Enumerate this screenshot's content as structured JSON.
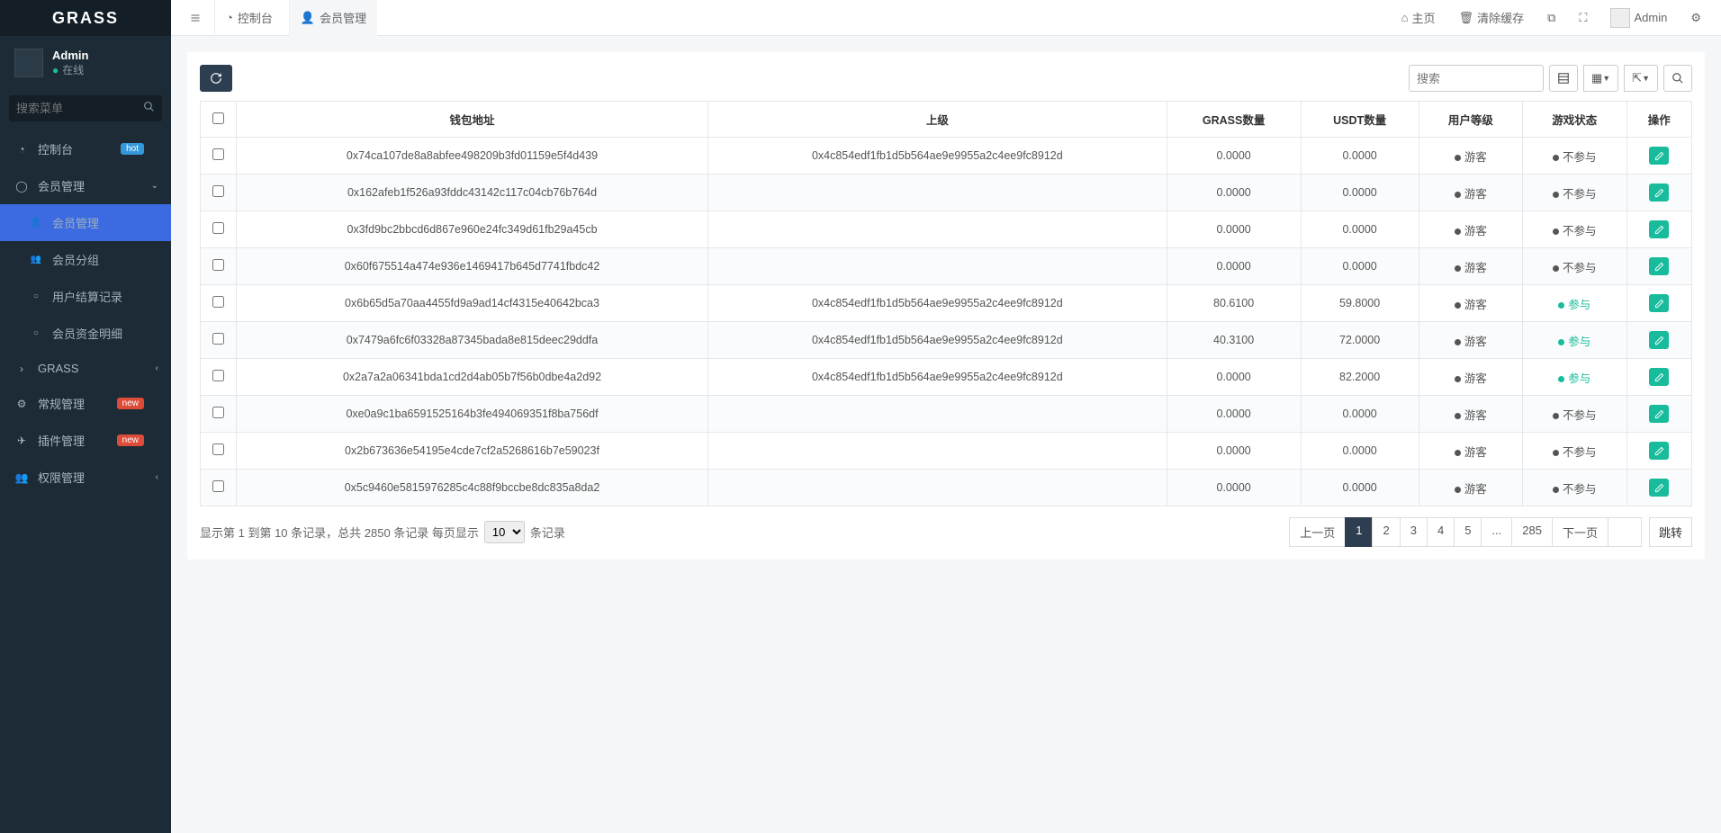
{
  "brand": "GRASS",
  "user": {
    "name": "Admin",
    "status": "在线"
  },
  "sidebar_search_placeholder": "搜索菜单",
  "nav": {
    "console": "控制台",
    "member_mgmt": "会员管理",
    "member_mgmt_sub": "会员管理",
    "member_group": "会员分组",
    "user_settle": "用户结算记录",
    "member_funds": "会员资金明细",
    "grass": "GRASS",
    "general": "常规管理",
    "plugin": "插件管理",
    "permission": "权限管理",
    "badge_hot": "hot",
    "badge_new": "new"
  },
  "tabs": {
    "console": "控制台",
    "member": "会员管理"
  },
  "top": {
    "home": "主页",
    "clear_cache": "清除缓存",
    "admin": "Admin"
  },
  "search_placeholder": "搜索",
  "columns": {
    "wallet": "钱包地址",
    "parent": "上级",
    "grass_qty": "GRASS数量",
    "usdt_qty": "USDT数量",
    "level": "用户等级",
    "game": "游戏状态",
    "op": "操作"
  },
  "level_guest": "游客",
  "game_no": "不参与",
  "game_yes": "参与",
  "rows": [
    {
      "wallet": "0x74ca107de8a8abfee498209b3fd01159e5f4d439",
      "parent": "0x4c854edf1fb1d5b564ae9e9955a2c4ee9fc8912d",
      "grass": "0.0000",
      "usdt": "0.0000",
      "game": "no"
    },
    {
      "wallet": "0x162afeb1f526a93fddc43142c117c04cb76b764d",
      "parent": "",
      "grass": "0.0000",
      "usdt": "0.0000",
      "game": "no"
    },
    {
      "wallet": "0x3fd9bc2bbcd6d867e960e24fc349d61fb29a45cb",
      "parent": "",
      "grass": "0.0000",
      "usdt": "0.0000",
      "game": "no"
    },
    {
      "wallet": "0x60f675514a474e936e1469417b645d7741fbdc42",
      "parent": "",
      "grass": "0.0000",
      "usdt": "0.0000",
      "game": "no"
    },
    {
      "wallet": "0x6b65d5a70aa4455fd9a9ad14cf4315e40642bca3",
      "parent": "0x4c854edf1fb1d5b564ae9e9955a2c4ee9fc8912d",
      "grass": "80.6100",
      "usdt": "59.8000",
      "game": "yes"
    },
    {
      "wallet": "0x7479a6fc6f03328a87345bada8e815deec29ddfa",
      "parent": "0x4c854edf1fb1d5b564ae9e9955a2c4ee9fc8912d",
      "grass": "40.3100",
      "usdt": "72.0000",
      "game": "yes"
    },
    {
      "wallet": "0x2a7a2a06341bda1cd2d4ab05b7f56b0dbe4a2d92",
      "parent": "0x4c854edf1fb1d5b564ae9e9955a2c4ee9fc8912d",
      "grass": "0.0000",
      "usdt": "82.2000",
      "game": "yes"
    },
    {
      "wallet": "0xe0a9c1ba6591525164b3fe494069351f8ba756df",
      "parent": "",
      "grass": "0.0000",
      "usdt": "0.0000",
      "game": "no"
    },
    {
      "wallet": "0x2b673636e54195e4cde7cf2a5268616b7e59023f",
      "parent": "",
      "grass": "0.0000",
      "usdt": "0.0000",
      "game": "no"
    },
    {
      "wallet": "0x5c9460e5815976285c4c88f9bccbe8dc835a8da2",
      "parent": "",
      "grass": "0.0000",
      "usdt": "0.0000",
      "game": "no"
    }
  ],
  "pager": {
    "info_prefix": "显示第 1 到第 10 条记录，总共 2850 条记录 每页显示",
    "info_suffix": "条记录",
    "size": "10",
    "prev": "上一页",
    "next": "下一页",
    "jump": "跳转",
    "pages": [
      "1",
      "2",
      "3",
      "4",
      "5",
      "...",
      "285"
    ]
  }
}
